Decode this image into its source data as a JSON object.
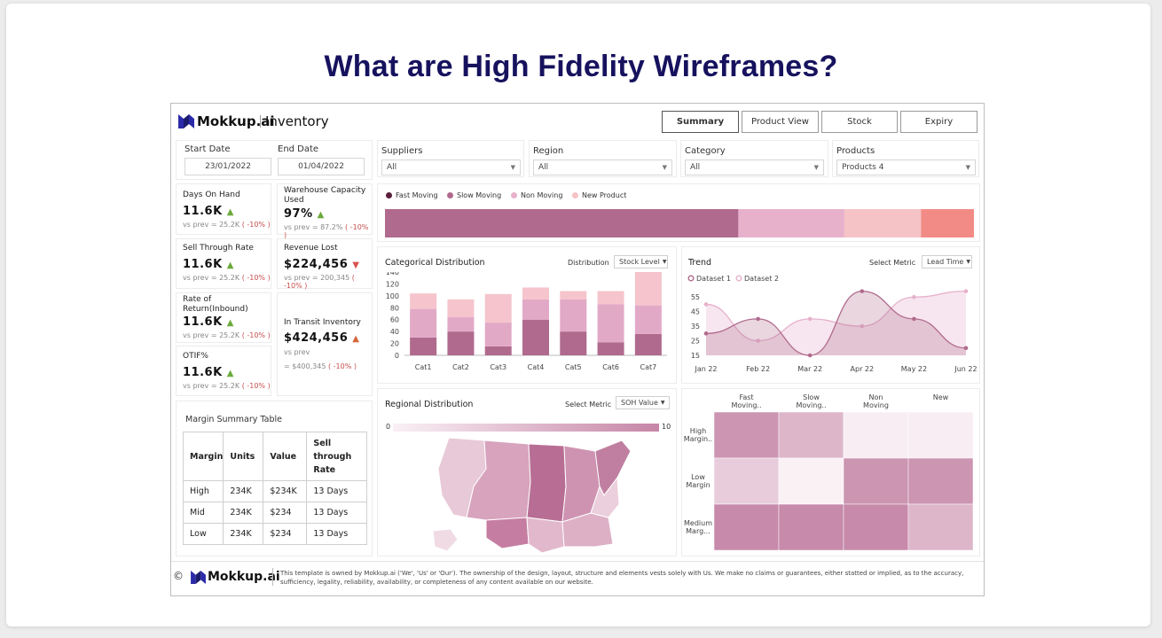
{
  "slide": {
    "title": "What are High Fidelity Wireframes?"
  },
  "header": {
    "logo_text": "Mokkup.ai",
    "page_name": "Inventory",
    "nav": [
      {
        "label": "Summary",
        "active": true
      },
      {
        "label": "Product View",
        "active": false
      },
      {
        "label": "Stock",
        "active": false
      },
      {
        "label": "Expiry",
        "active": false
      }
    ]
  },
  "dates": {
    "start_label": "Start Date",
    "start_value": "23/01/2022",
    "end_label": "End Date",
    "end_value": "01/04/2022"
  },
  "filters": [
    {
      "label": "Suppliers",
      "value": "All"
    },
    {
      "label": "Region",
      "value": "All"
    },
    {
      "label": "Category",
      "value": "All"
    },
    {
      "label": "Products",
      "value": "Products 4"
    }
  ],
  "kpis": {
    "days_on_hand": {
      "title": "Days On Hand",
      "value": "11.6K",
      "prev": "vs prev = 25.2K",
      "pct": "( -10% )"
    },
    "warehouse": {
      "title": "Warehouse Capacity Used",
      "value": "97%",
      "prev": "vs prev = 87.2%",
      "pct": "( -10% )"
    },
    "sell_through": {
      "title": "Sell Through Rate",
      "value": "11.6K",
      "prev": "vs prev = 25.2K",
      "pct": "( -10% )"
    },
    "revenue_lost": {
      "title": "Revenue Lost",
      "value": "$224,456",
      "prev": "vs prev = 200,345",
      "pct": "( -10% )"
    },
    "return_rate": {
      "title": "Rate of Return(Inbound)",
      "value": "11.6K",
      "prev": "vs prev = 25.2K",
      "pct": "( -10% )"
    },
    "in_transit": {
      "title": "In Transit Inventory",
      "value": "$424,456",
      "prev1": "vs prev",
      "prev2": "= $400,345",
      "pct": "( -10% )"
    },
    "otif": {
      "title": "OTIF%",
      "value": "11.6K",
      "prev": "vs prev = 25.2K",
      "pct": "( -10% )"
    }
  },
  "movement": {
    "legend": [
      {
        "label": "Fast Moving",
        "color": "#5a1f3a"
      },
      {
        "label": "Slow Moving",
        "color": "#b06a8d"
      },
      {
        "label": "Non Moving",
        "color": "#e7b1cc"
      },
      {
        "label": "New Product",
        "color": "#f5c3c6"
      }
    ],
    "segments": [
      {
        "share": 0.6,
        "color": "#b06a8d"
      },
      {
        "share": 0.18,
        "color": "#e7b1cc"
      },
      {
        "share": 0.13,
        "color": "#f5c3c6"
      },
      {
        "share": 0.09,
        "color": "#f28b86"
      }
    ]
  },
  "margin_table": {
    "title": "Margin Summary Table",
    "headers": [
      "Margin",
      "Units",
      "Value",
      "Sell through Rate"
    ],
    "rows": [
      [
        "High",
        "234K",
        "$234K",
        "13 Days"
      ],
      [
        "Mid",
        "234K",
        "$234",
        "13 Days"
      ],
      [
        "Low",
        "234K",
        "$234",
        "13 Days"
      ]
    ]
  },
  "categorical": {
    "title": "Categorical Distribution",
    "control_label": "Distribution",
    "control_value": "Stock Level"
  },
  "trend": {
    "title": "Trend",
    "control_label": "Select Metric",
    "control_value": "Lead Time",
    "legend": [
      "Dataset 1",
      "Dataset 2"
    ]
  },
  "regional": {
    "title": "Regional Distribution",
    "control_label": "Select Metric",
    "control_value": "SOH Value",
    "scale_min": "0",
    "scale_max": "10"
  },
  "footer": {
    "copyright": "©",
    "logo_text": "Mokkup.ai",
    "text": "This template is owned by Mokkup.ai ('We', 'Us' or 'Our'). The ownership of the design, layout, structure and elements vests solely with Us. We make no claims or guarantees, either statted or implied, as to the accuracy, sufficiency, legality, reliability, availability, or completeness of any content available on our website."
  },
  "chart_data": [
    {
      "type": "bar",
      "stacked": true,
      "categories": [
        "Cat1",
        "Cat2",
        "Cat3",
        "Cat4",
        "Cat5",
        "Cat6",
        "Cat7"
      ],
      "series": [
        {
          "values": [
            30,
            40,
            15,
            60,
            40,
            22,
            36
          ],
          "color": "#b06a8d"
        },
        {
          "values": [
            48,
            24,
            40,
            34,
            54,
            64,
            48
          ],
          "color": "#e2a9c6"
        },
        {
          "values": [
            26,
            30,
            48,
            20,
            14,
            22,
            56
          ],
          "color": "#f5c4cc"
        }
      ],
      "yticks": [
        0,
        20,
        40,
        60,
        80,
        100,
        120,
        140
      ],
      "ylim": [
        0,
        140
      ]
    },
    {
      "type": "area",
      "x": [
        "Jan 22",
        "Feb 22",
        "Mar 22",
        "Apr 22",
        "May 22",
        "Jun 22"
      ],
      "series": [
        {
          "name": "Dataset 1",
          "values": [
            30,
            40,
            15,
            59,
            40,
            20
          ],
          "color": "#b06a8d"
        },
        {
          "name": "Dataset 2",
          "values": [
            50,
            25,
            40,
            35,
            55,
            59
          ],
          "color": "#e7b1cc"
        }
      ],
      "yticks": [
        15,
        25,
        35,
        45,
        55
      ],
      "ylim": [
        15,
        60
      ]
    },
    {
      "type": "heatmap",
      "columns": [
        "Fast Moving..",
        "Slow Moving..",
        "Non Moving",
        "New"
      ],
      "rows": [
        "High Margin..",
        "Low Margin",
        "Medium Marg..."
      ],
      "values": [
        [
          0.85,
          0.55,
          0.05,
          0.05
        ],
        [
          0.35,
          0.02,
          0.85,
          0.85
        ],
        [
          0.95,
          0.95,
          0.95,
          0.55
        ]
      ]
    }
  ]
}
